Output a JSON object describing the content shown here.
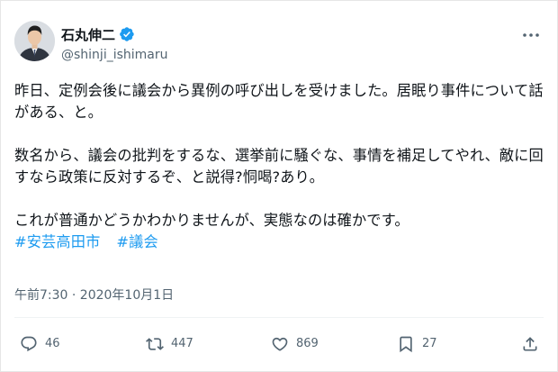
{
  "author": {
    "display_name": "石丸伸二",
    "handle": "@shinji_ishimaru",
    "verified_icon": "verified-badge-icon"
  },
  "tweet": {
    "paragraphs": [
      "昨日、定例会後に議会から異例の呼び出しを受けました。居眠り事件について話がある、と。",
      "数名から、議会の批判をするな、選挙前に騒ぐな、事情を補足してやれ、敵に回すなら政策に反対するぞ、と説得?恫喝?あり。",
      "これが普通かどうかわかりませんが、実態なのは確かです。"
    ],
    "hashtags": [
      "#安芸高田市",
      "#議会"
    ],
    "timestamp": "午前7:30 · 2020年10月1日"
  },
  "actions": {
    "reply_count": "46",
    "retweet_count": "447",
    "like_count": "869",
    "bookmark_count": "27"
  },
  "colors": {
    "text": "#0f1419",
    "secondary": "#536471",
    "link": "#1d9bf0",
    "verified": "#1d9bf0"
  }
}
